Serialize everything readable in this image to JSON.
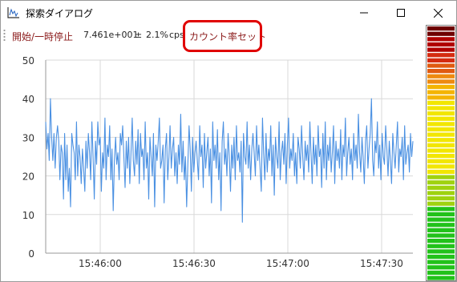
{
  "window": {
    "title": "探索ダイアログ",
    "icon": "chart-app-icon"
  },
  "toolbar": {
    "start_stop_label": "開始/一時停止",
    "rate_value": "7.461e+001",
    "plus_minus": "±",
    "rate_error": "2.1%",
    "rate_unit": "cps",
    "set_rate_label": "カウント率セット"
  },
  "colors": {
    "series": "#4a90e2",
    "grid": "#d9d9d9",
    "highlight": "#e00000",
    "toolbar_text": "#8b1a1a"
  },
  "meter": {
    "type": "vertical-level-meter",
    "level": 0.0
  },
  "chart_data": {
    "type": "line",
    "title": "",
    "xlabel": "",
    "ylabel": "",
    "ylim": [
      0,
      50
    ],
    "yticks": [
      "0",
      "10",
      "20",
      "30",
      "40",
      "50"
    ],
    "xtick_labels": [
      "15:46:00",
      "15:46:30",
      "15:47:00",
      "15:47:30"
    ],
    "grid": true,
    "series": [
      {
        "values": [
          34,
          27,
          31,
          24,
          40,
          30,
          24,
          31,
          22,
          30,
          33,
          29,
          19,
          28,
          26,
          14,
          31,
          19,
          28,
          16,
          22,
          12,
          31,
          28,
          26,
          19,
          34,
          20,
          28,
          25,
          18,
          27,
          22,
          16,
          29,
          22,
          31,
          26,
          19,
          34,
          25,
          14,
          29,
          23,
          34,
          28,
          30,
          16,
          26,
          22,
          35,
          19,
          28,
          25,
          33,
          19,
          27,
          11,
          24,
          30,
          23,
          26,
          19,
          31,
          28,
          33,
          25,
          17,
          29,
          22,
          30,
          18,
          26,
          35,
          24,
          20,
          29,
          23,
          32,
          18,
          31,
          25,
          27,
          19,
          34,
          22,
          26,
          14,
          30,
          25,
          20,
          31,
          12,
          28,
          24,
          29,
          35,
          22,
          24,
          28,
          13,
          27,
          31,
          19,
          25,
          33,
          22,
          27,
          30,
          20,
          26,
          18,
          28,
          23,
          36,
          21,
          29,
          19,
          25,
          12,
          23,
          33,
          27,
          16,
          30,
          21,
          26,
          29,
          24,
          19,
          33,
          25,
          28,
          17,
          31,
          22,
          26,
          30,
          20,
          27,
          13,
          34,
          24,
          28,
          22,
          32,
          19,
          26,
          11,
          29,
          34,
          23,
          27,
          20,
          31,
          25,
          16,
          28,
          22,
          30,
          19,
          33,
          24,
          26,
          21,
          29,
          8,
          31,
          25,
          23,
          34,
          22,
          28,
          19,
          27,
          31,
          26,
          20,
          33,
          24,
          28,
          22,
          16,
          35,
          26,
          19,
          31,
          21,
          27,
          24,
          33,
          20,
          28,
          15,
          30,
          25,
          22,
          34,
          19,
          26,
          29,
          23,
          31,
          18,
          28,
          35,
          22,
          27,
          24,
          31,
          20,
          26,
          18,
          30,
          27,
          22,
          33,
          25,
          19,
          29,
          24,
          28,
          21,
          34,
          26,
          18,
          30,
          23,
          28,
          20,
          33,
          25,
          27,
          17,
          31,
          22,
          34,
          19,
          28,
          24,
          30,
          21,
          26,
          33,
          18,
          29,
          24,
          27,
          22,
          32,
          19,
          28,
          25,
          35,
          20,
          26,
          30,
          23,
          27,
          19,
          31,
          24,
          28,
          22,
          36,
          26,
          21,
          30,
          25,
          18,
          29,
          33,
          22,
          27,
          31,
          40,
          24,
          20,
          29,
          26,
          34,
          22,
          28,
          19,
          31,
          25,
          23,
          33,
          27,
          20,
          29,
          24,
          18,
          31,
          26,
          22,
          28,
          34,
          21,
          27,
          25,
          30,
          19,
          33,
          23,
          26,
          28,
          21,
          31,
          25,
          29
        ]
      }
    ]
  }
}
